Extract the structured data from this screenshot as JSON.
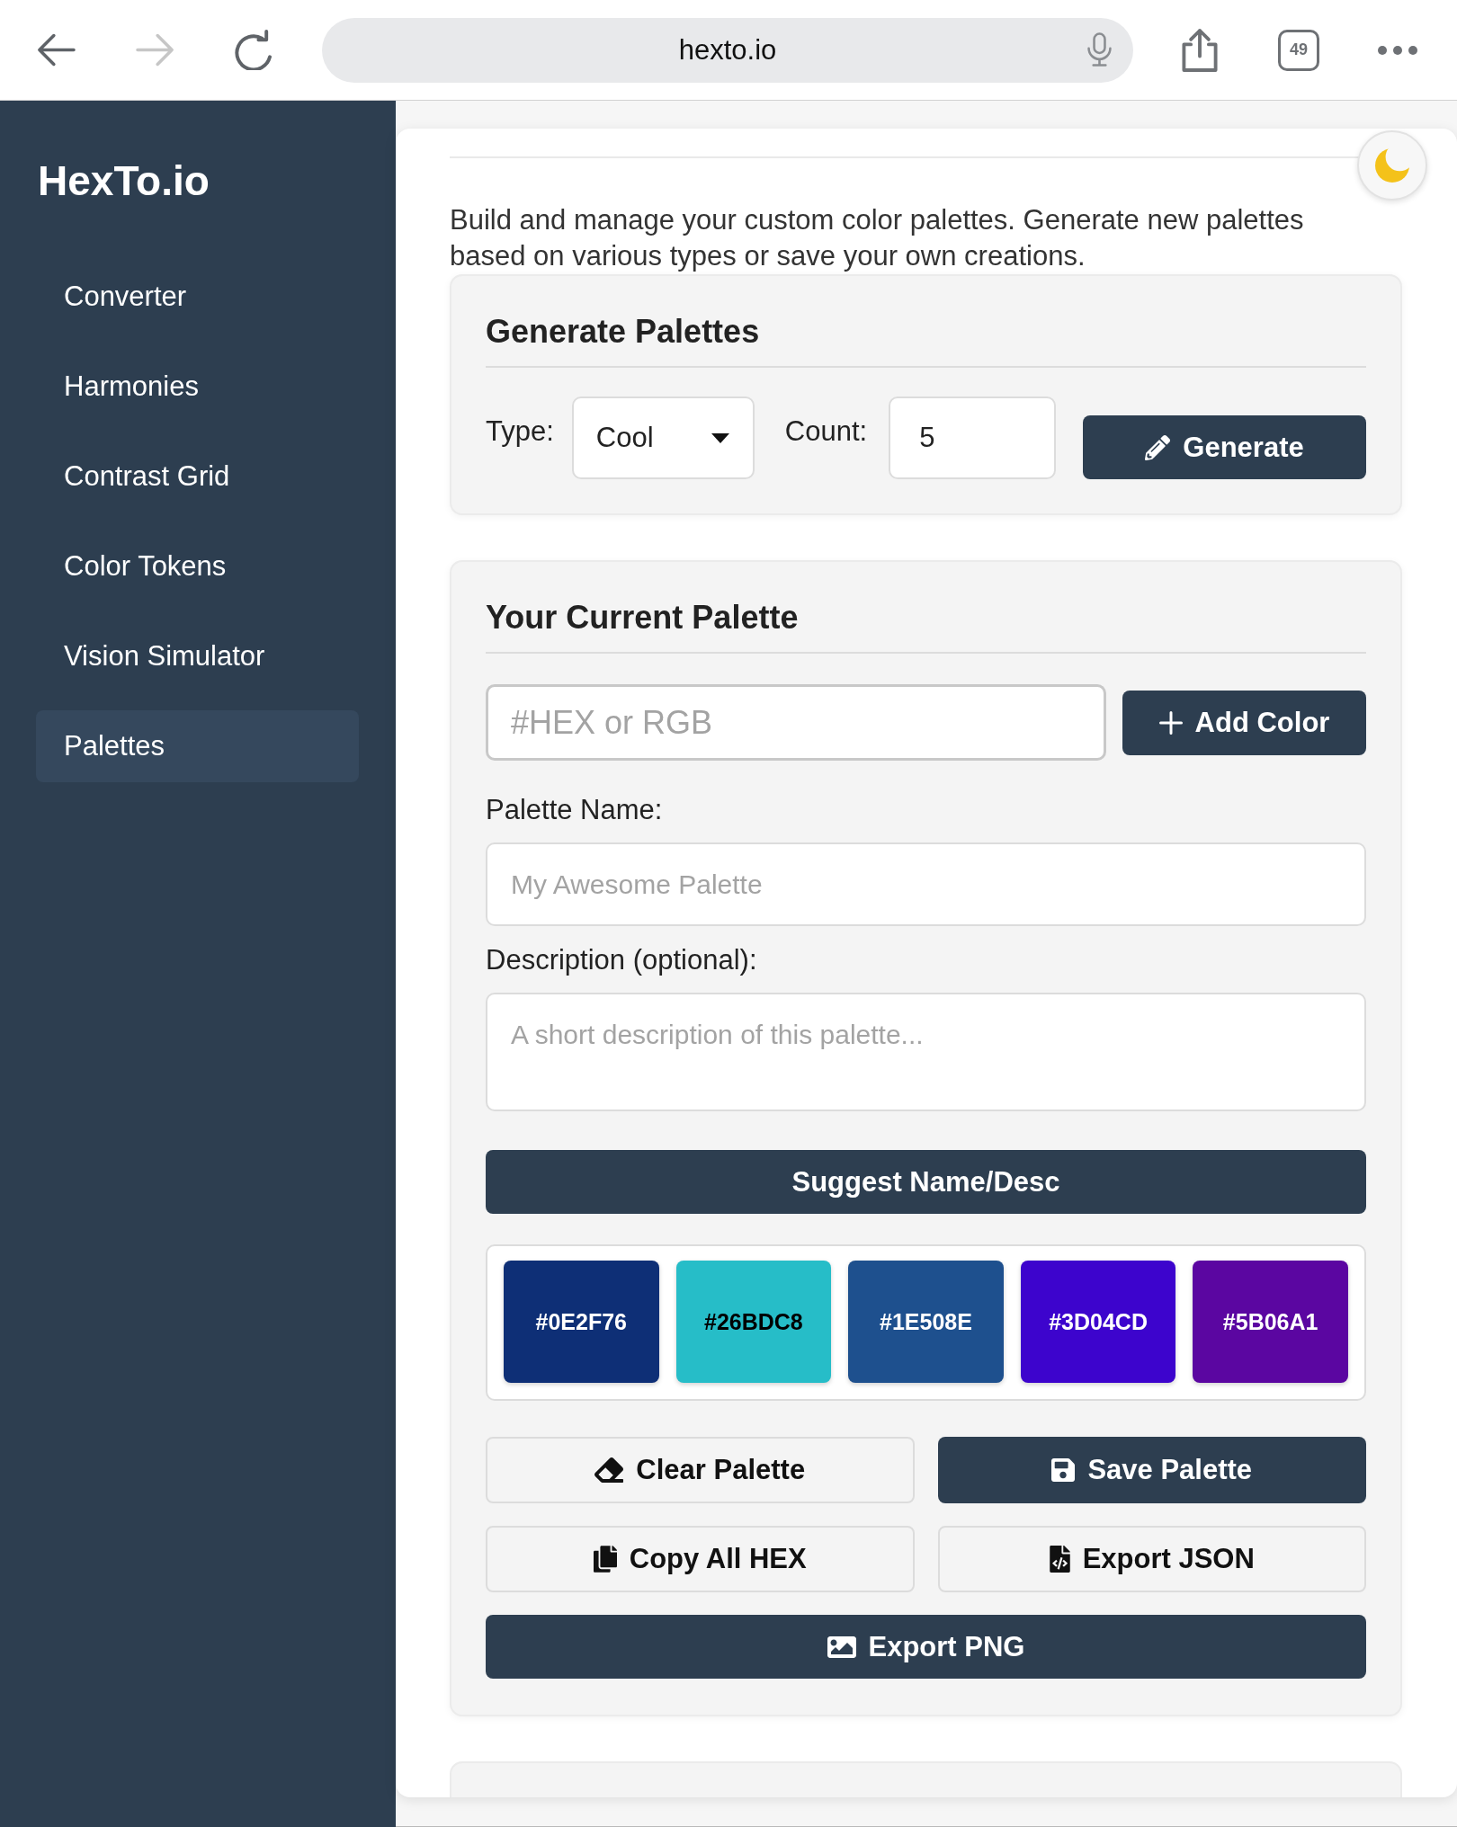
{
  "browser": {
    "back_disabled": false,
    "forward_disabled": true,
    "url": "hexto.io",
    "tab_count": "49"
  },
  "sidebar": {
    "logo": "HexTo.io",
    "items": [
      {
        "label": "Converter",
        "selected": false
      },
      {
        "label": "Harmonies",
        "selected": false
      },
      {
        "label": "Contrast Grid",
        "selected": false
      },
      {
        "label": "Color Tokens",
        "selected": false
      },
      {
        "label": "Vision Simulator",
        "selected": false
      },
      {
        "label": "Palettes",
        "selected": true
      }
    ]
  },
  "intro": "Build and manage your custom color palettes. Generate new palettes based on various types or save your own creations.",
  "generate_panel": {
    "title": "Generate Palettes",
    "type_label": "Type:",
    "type_value": "Cool",
    "count_label": "Count:",
    "count_value": "5",
    "generate_button": "Generate"
  },
  "current_palette": {
    "title": "Your Current Palette",
    "color_field": {
      "placeholder": "#HEX or RGB"
    },
    "add_button": "Add Color",
    "name_label": "Palette Name:",
    "name_field": {
      "placeholder": "My Awesome Palette"
    },
    "description_label": "Description (optional):",
    "description_field": {
      "placeholder": "A short description of this palette..."
    },
    "suggest_button": "Suggest Name/Desc",
    "swatches": [
      {
        "label": "#0E2F76",
        "color": "#0e2f76"
      },
      {
        "label": "#26BDC8",
        "color": "#26bdc8"
      },
      {
        "label": "#1E508E",
        "color": "#1e508e"
      },
      {
        "label": "#3D04CD",
        "color": "#3d04cd"
      },
      {
        "label": "#5B06A1",
        "color": "#5b06a1"
      }
    ],
    "actions": [
      {
        "label": "Clear Palette",
        "kind": "outline"
      },
      {
        "label": "Save Palette",
        "kind": "solid"
      },
      {
        "label": "Copy All HEX",
        "kind": "outline"
      },
      {
        "label": "Export JSON",
        "kind": "outline"
      },
      {
        "label": "Export PNG",
        "kind": "solid"
      }
    ]
  }
}
